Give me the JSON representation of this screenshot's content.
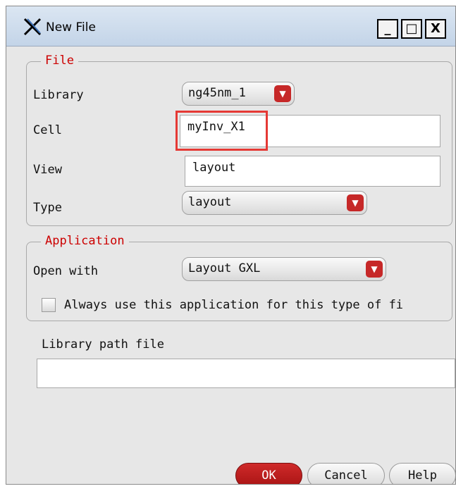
{
  "window": {
    "title": "New File",
    "minimize_label": "_",
    "maximize_label": "□",
    "close_label": "X",
    "app_icon": "x-cadence-icon"
  },
  "file_group": {
    "legend": "File",
    "library_label": "Library",
    "library_value": "ng45nm_1",
    "cell_label": "Cell",
    "cell_value": "myInv_X1",
    "view_label": "View",
    "view_value": "layout",
    "type_label": "Type",
    "type_value": "layout"
  },
  "app_group": {
    "legend": "Application",
    "open_with_label": "Open with",
    "open_with_value": "Layout GXL",
    "always_use_label": "Always use this application for this type of fi",
    "always_use_checked": false
  },
  "library_path": {
    "label": "Library path file",
    "value": ""
  },
  "buttons": {
    "ok": "OK",
    "cancel": "Cancel",
    "help": "Help"
  },
  "colors": {
    "accent": "#c62828",
    "legend": "#cc0000",
    "highlight": "#e53935"
  }
}
